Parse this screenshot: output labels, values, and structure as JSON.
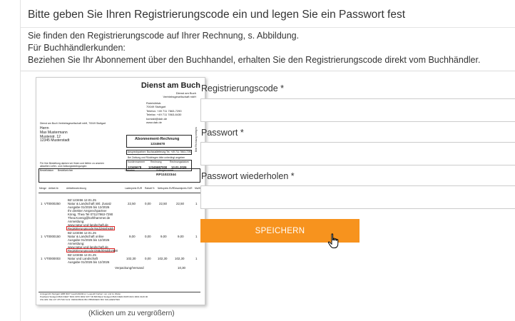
{
  "header": {
    "title": "Bitte geben Sie Ihren Registrierungscode ein und legen Sie ein Passwort fest",
    "line1": "Sie finden den Registrierungscode auf Ihrer Rechnung, s. Abbildung.",
    "line2": "Für Buchhändlerkunden:",
    "line3": "Beziehen Sie Ihr Abonnement über den Buchhandel, erhalten Sie den Registrierungscode direkt vom Buchhändler."
  },
  "invoice": {
    "brand": "Dienst am Buch",
    "brand_sub1": "Dienst am Buch",
    "brand_sub2": "Vertriebsgesellschaft mbH",
    "addr_right": [
      "Rotebühlstr.",
      "70049 Stuttgart",
      "Telefon: +49 711 7863-7290",
      "Telefax: +49 711 7863-8430",
      "kontakt@dab.de",
      "www.dab.de"
    ],
    "sender_line": "Dienst am Buch Vertriebsgesellschaft mbH, 70049 Stuttgart",
    "recipient": [
      "Herrn",
      "Max Mustermann",
      "Musterstr. 12",
      "12345 Musterstadt"
    ],
    "doc_title": "Abonnement-Rechnung",
    "doc_no": "12345678",
    "contact_line": "Ansprechpartner: Buchauslieferung Tel. +49 711 7863-7290",
    "due_line": "Bei Zahlung und Rückfragen bitte unbedingt angeben",
    "meta_labels": [
      "Kundennummer",
      "Rechnung",
      "Rechnungsdatum"
    ],
    "meta_values": [
      "12345678",
      "12345687000",
      "13.01.2026"
    ],
    "note_left": [
      "Für Ihre Bestellung danken wir Ihnen und liefern zu unseren",
      "aktuellen Liefer- und Zahlungsbedingungen:"
    ],
    "table_heads1": [
      "Bestelldatum",
      "Bestellzeichen",
      "Verlosten",
      "Auftragsnummer"
    ],
    "order_no": "RP11022344",
    "col_heads": [
      "Menge",
      "Artikel-Nr.",
      "Artikelbezeichnung",
      "Ladenpreis EUR",
      "Rabatt %",
      "Nettopreis EUR",
      "Gesamtpreis EUR",
      "MwSt"
    ],
    "items": [
      {
        "ref": "BZ:123456 12.01.25",
        "qty": "1",
        "art": "VT0000250",
        "desc": [
          "Natur & Landschaft inkl. Zusatz",
          "Ausgabe 01/2026 bis 12/2026",
          "Ihr direkter Ansprechpartner",
          "König, Thea Tel 0711/7863-7290",
          "Thea.Koenig@kohlhammer.de",
          "Anmeldung:",
          "www.natur-und-landschaft.de"
        ],
        "code": "Registrierungscode:Nsd1Nsshstkh",
        "prices": [
          "22,50",
          "0,00",
          "22,50",
          "22,50",
          "1"
        ]
      },
      {
        "ref": "BZ:123456 12.01.25",
        "qty": "1",
        "art": "VT0000150",
        "desc": [
          "Natur & Landschaft online",
          "Ausgabe 01/2026 bis 12/2026",
          "Anmeldung:",
          "www.natur-und-landschaft.de"
        ],
        "code": "Registrierungscode:D5Bdrb5ddbz888",
        "prices": [
          "9,00",
          "0,00",
          "9,00",
          "9,00",
          "1"
        ]
      },
      {
        "ref": "BZ:123456 12.01.25",
        "qty": "1",
        "art": "VT0000003",
        "desc": [
          "Natur und Landschaft",
          "Ausgabe 01/2026 bis 12/2026"
        ],
        "code": "",
        "prices": [
          "102,30",
          "0,00",
          "102,30",
          "102,30",
          "1"
        ]
      }
    ],
    "shipping_label": "Verpackung/Versand",
    "shipping_value": "10,30",
    "side_text": "Bitte Rechnung beilegen",
    "footer1": "Amtsgericht Stuttgart HRB 9027 Geschäftsführer: Leopold Freiherr von und zu Weiler",
    "footer2": "Postbank Stuttgart   IBAN DE07 6001 0070 0002 3477 00   BW-Bank Stuttgart   IBAN DE64 6005 0101 0001 0146 00",
    "footer3": "USt-IdNr. DE 147 475 516 St.Nr. 99201/08131   BIC PBNKDEFF   BIC SOLADEST600",
    "caption": "(Klicken um zu vergrößern)"
  },
  "form": {
    "code_label": "Registrierungscode *",
    "code_value": "",
    "password_label": "Passwort *",
    "password_value": "",
    "password_repeat_label": "Passwort wiederholen *",
    "password_repeat_value": "",
    "submit_label": "SPEICHERN"
  },
  "colors": {
    "accent": "#f7931e",
    "highlight_red": "#dd2222"
  },
  "icons": {
    "cursor": "hand-pointer-icon"
  }
}
